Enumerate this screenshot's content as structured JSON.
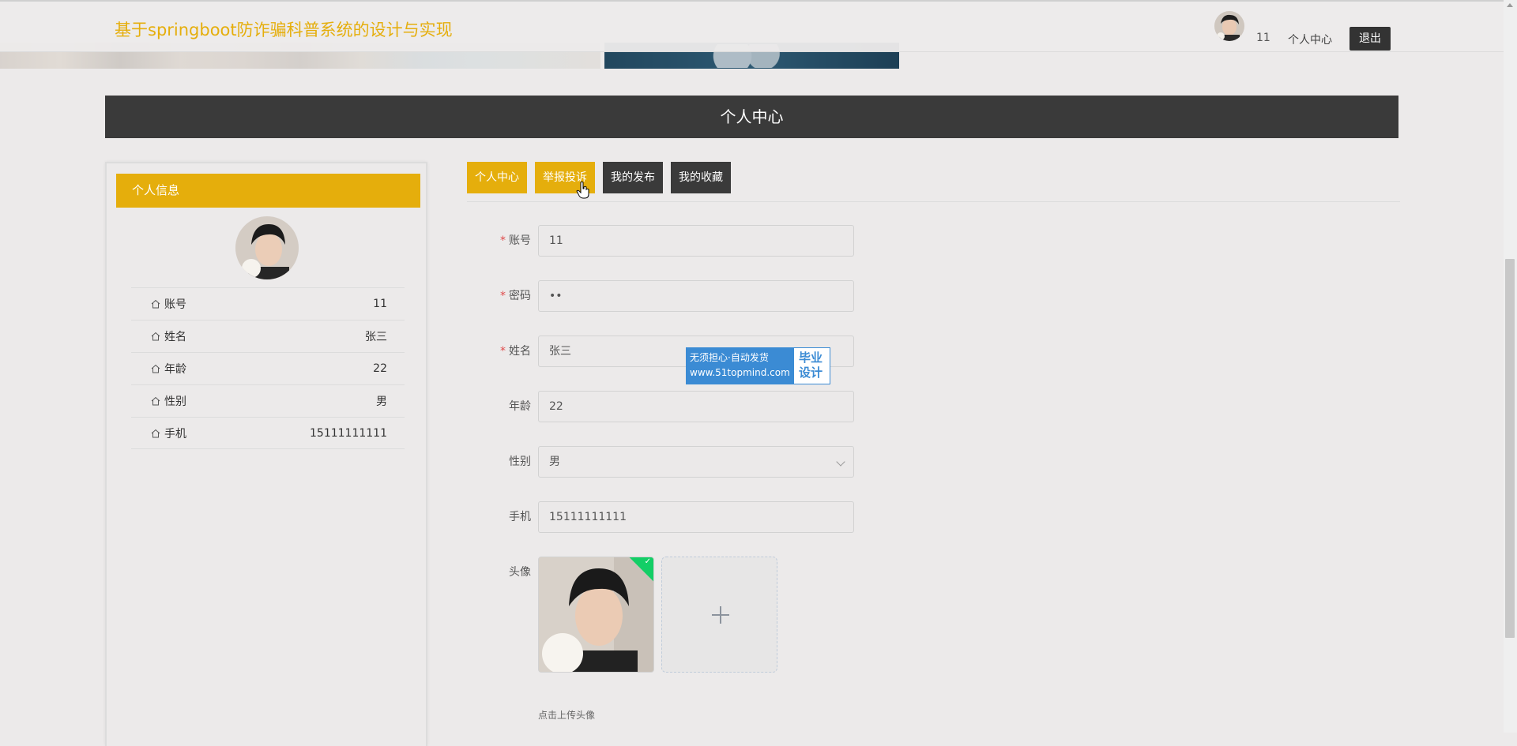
{
  "header": {
    "site_title": "基于springboot防诈骗科普系统的设计与实现",
    "username": "11",
    "center_link": "个人中心",
    "logout_label": "退出"
  },
  "section": {
    "title": "个人中心"
  },
  "sidebar": {
    "title": "个人信息",
    "rows": [
      {
        "label": "账号",
        "value": "11"
      },
      {
        "label": "姓名",
        "value": "张三"
      },
      {
        "label": "年龄",
        "value": "22"
      },
      {
        "label": "性别",
        "value": "男"
      },
      {
        "label": "手机",
        "value": "15111111111"
      }
    ]
  },
  "tabs": [
    {
      "label": "个人中心"
    },
    {
      "label": "举报投诉"
    },
    {
      "label": "我的发布"
    },
    {
      "label": "我的收藏"
    }
  ],
  "form": {
    "account": {
      "label": "账号",
      "value": "11"
    },
    "password": {
      "label": "密码",
      "value": "••"
    },
    "name": {
      "label": "姓名",
      "value": "张三"
    },
    "age": {
      "label": "年龄",
      "value": "22"
    },
    "gender": {
      "label": "性别",
      "value": "男"
    },
    "phone": {
      "label": "手机",
      "value": "15111111111"
    },
    "avatar": {
      "label": "头像",
      "tip": "点击上传头像"
    }
  },
  "watermark": {
    "line1": "无须担心·自动发货",
    "line2": "www.51topmind.com",
    "side1": "毕业",
    "side2": "设计"
  },
  "colors": {
    "accent": "#e5ae0c",
    "dark": "#3a3a3a",
    "background": "#eceaea"
  }
}
